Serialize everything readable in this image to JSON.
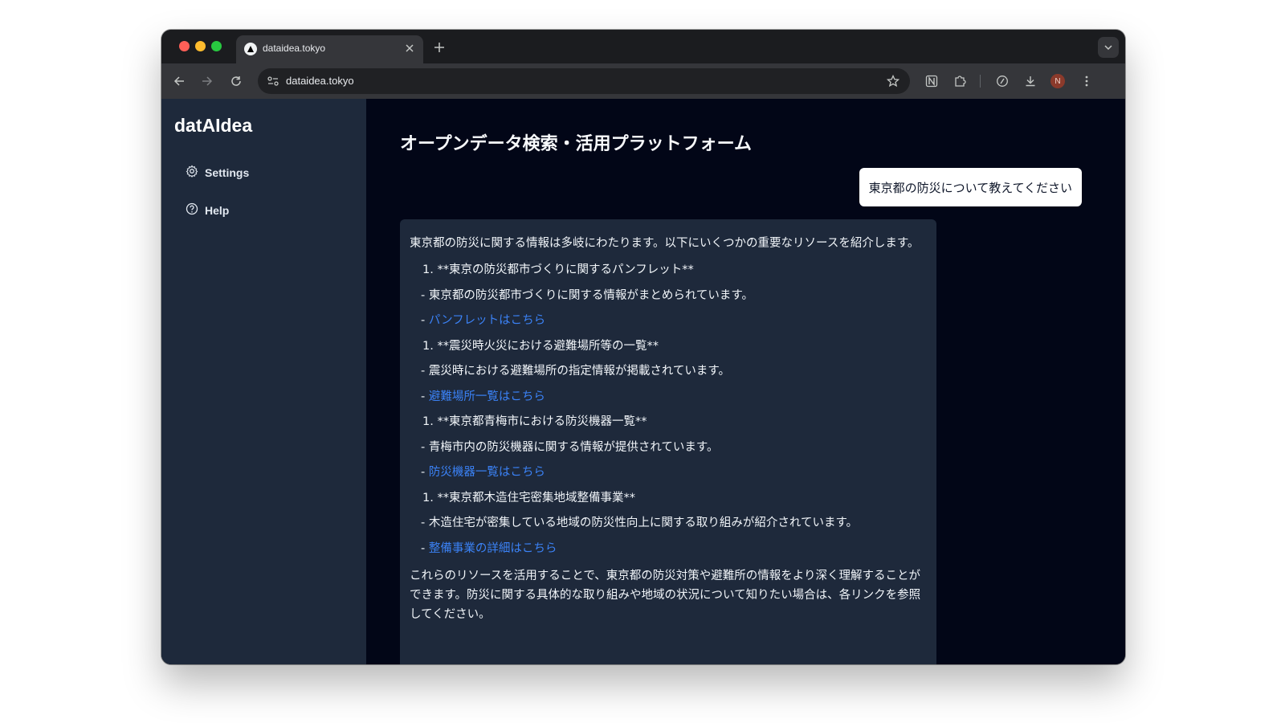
{
  "browser": {
    "tab_title": "dataidea.tokyo",
    "address": "dataidea.tokyo",
    "avatar_letter": "N"
  },
  "sidebar": {
    "brand": "datAIdea",
    "items": [
      {
        "label": "Settings",
        "icon": "gear-icon"
      },
      {
        "label": "Help",
        "icon": "help-circle-icon"
      }
    ]
  },
  "main": {
    "title": "オープンデータ検索・活用プラットフォーム",
    "user_message": "東京都の防災について教えてください",
    "response": {
      "intro": "東京都の防災に関する情報は多岐にわたります。以下にいくつかの重要なリソースを紹介します。",
      "sections": [
        {
          "heading": "1. **東京の防災都市づくりに関するパンフレット**",
          "detail": "- 東京都の防災都市づくりに関する情報がまとめられています。",
          "link_prefix": "- ",
          "link_text": "パンフレットはこちら"
        },
        {
          "heading": "1. **震災時火災における避難場所等の一覧**",
          "detail": "- 震災時における避難場所の指定情報が掲載されています。",
          "link_prefix": "- ",
          "link_text": "避難場所一覧はこちら"
        },
        {
          "heading": "1. **東京都青梅市における防災機器一覧**",
          "detail": "- 青梅市内の防災機器に関する情報が提供されています。",
          "link_prefix": "- ",
          "link_text": "防災機器一覧はこちら"
        },
        {
          "heading": "1. **東京都木造住宅密集地域整備事業**",
          "detail": "- 木造住宅が密集している地域の防災性向上に関する取り組みが紹介されています。",
          "link_prefix": "- ",
          "link_text": "整備事業の詳細はこちら"
        }
      ],
      "outro": "これらのリソースを活用することで、東京都の防災対策や避難所の情報をより深く理解することができます。防災に関する具体的な取り組みや地域の状況について知りたい場合は、各リンクを参照してください。"
    }
  },
  "colors": {
    "sidebar_bg": "#1e293b",
    "page_bg": "#020617",
    "link": "#3b82f6"
  }
}
